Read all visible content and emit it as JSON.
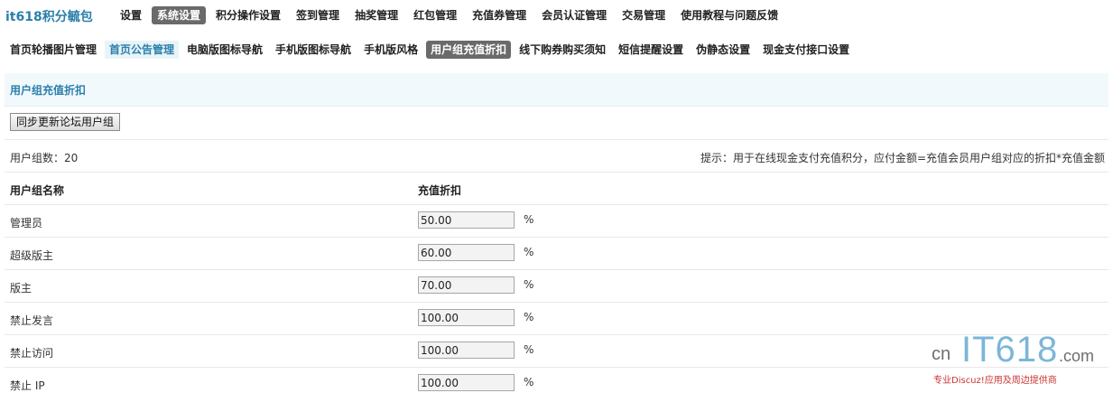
{
  "brand": "it618积分毓包",
  "top_menu": [
    {
      "label": "设置",
      "active": false
    },
    {
      "label": "系统设置",
      "active": true
    },
    {
      "label": "积分操作设置",
      "active": false
    },
    {
      "label": "签到管理",
      "active": false
    },
    {
      "label": "抽奖管理",
      "active": false
    },
    {
      "label": "红包管理",
      "active": false
    },
    {
      "label": "充值券管理",
      "active": false
    },
    {
      "label": "会员认证管理",
      "active": false
    },
    {
      "label": "交易管理",
      "active": false
    },
    {
      "label": "使用教程与问题反馈",
      "active": false
    }
  ],
  "sub_menu": [
    {
      "label": "首页轮播图片管理",
      "state": ""
    },
    {
      "label": "首页公告管理",
      "state": "highlight"
    },
    {
      "label": "电脑版图标导航",
      "state": ""
    },
    {
      "label": "手机版图标导航",
      "state": ""
    },
    {
      "label": "手机版风格",
      "state": ""
    },
    {
      "label": "用户组充值折扣",
      "state": "active"
    },
    {
      "label": "线下购券购买须知",
      "state": ""
    },
    {
      "label": "短信提醒设置",
      "state": ""
    },
    {
      "label": "伪静态设置",
      "state": ""
    },
    {
      "label": "现金支付接口设置",
      "state": ""
    }
  ],
  "section_title": "用户组充值折扣",
  "sync_button": "同步更新论坛用户组",
  "count": {
    "label": "用户组数：",
    "value": "20"
  },
  "tip": "提示：用于在线现金支付充值积分，应付金额=充值会员用户组对应的折扣*充值金额",
  "table": {
    "headers": [
      "用户组名称",
      "充值折扣"
    ],
    "unit": "%",
    "rows": [
      {
        "name": "管理员",
        "value": "50.00"
      },
      {
        "name": "超级版主",
        "value": "60.00"
      },
      {
        "name": "版主",
        "value": "70.00"
      },
      {
        "name": "禁止发言",
        "value": "100.00"
      },
      {
        "name": "禁止访问",
        "value": "100.00"
      },
      {
        "name": "禁止 IP",
        "value": "100.00"
      }
    ]
  },
  "watermark": {
    "cn": "cn",
    "it": "IT618",
    "com": ".com",
    "sub": "专业Discuz!应用及周边提供商"
  },
  "colors": {
    "accent": "#2b7fab",
    "active_tab_bg": "#6a6a6a",
    "header_bg": "#f2f9fd"
  }
}
